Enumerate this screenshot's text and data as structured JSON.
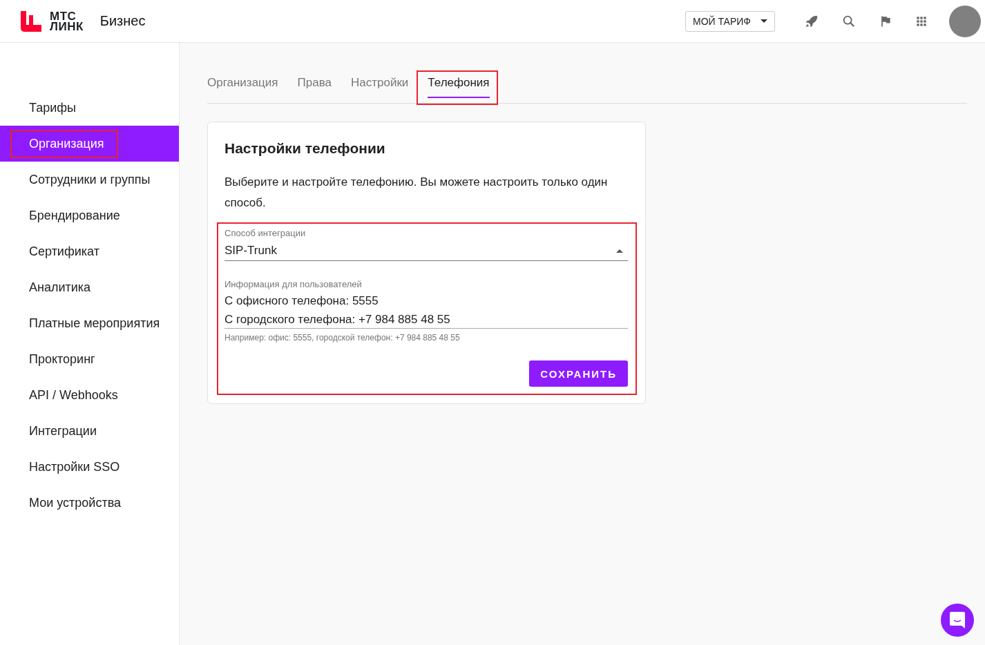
{
  "header": {
    "logo_line1": "МТС",
    "logo_line2": "ЛИНК",
    "product": "Бизнес",
    "plan_button": "МОЙ ТАРИФ"
  },
  "sidebar": {
    "items": [
      {
        "label": "Тарифы",
        "selected": false,
        "highlighted": false
      },
      {
        "label": "Организация",
        "selected": true,
        "highlighted": true
      },
      {
        "label": "Сотрудники и группы",
        "selected": false,
        "highlighted": false
      },
      {
        "label": "Брендирование",
        "selected": false,
        "highlighted": false
      },
      {
        "label": "Сертификат",
        "selected": false,
        "highlighted": false
      },
      {
        "label": "Аналитика",
        "selected": false,
        "highlighted": false
      },
      {
        "label": "Платные мероприятия",
        "selected": false,
        "highlighted": false
      },
      {
        "label": "Прокторинг",
        "selected": false,
        "highlighted": false
      },
      {
        "label": "API / Webhooks",
        "selected": false,
        "highlighted": false
      },
      {
        "label": "Интеграции",
        "selected": false,
        "highlighted": false
      },
      {
        "label": "Настройки SSO",
        "selected": false,
        "highlighted": false
      },
      {
        "label": "Мои устройства",
        "selected": false,
        "highlighted": false
      }
    ]
  },
  "tabs": [
    {
      "label": "Организация",
      "selected": false,
      "highlighted": false
    },
    {
      "label": "Права",
      "selected": false,
      "highlighted": false
    },
    {
      "label": "Настройки",
      "selected": false,
      "highlighted": false
    },
    {
      "label": "Телефония",
      "selected": true,
      "highlighted": true
    }
  ],
  "card": {
    "title": "Настройки телефонии",
    "description": "Выберите и настройте телефонию. Вы можете настроить только один способ.",
    "form": {
      "highlighted": true,
      "select": {
        "label": "Способ интеграции",
        "value": "SIP-Trunk",
        "expanded": true
      },
      "info": {
        "label": "Информация для пользователей",
        "lines": [
          "С офисного телефона: 5555",
          "С городского телефона: +7 984 885 48 55"
        ],
        "hint": "Например: офис: 5555, городской телефон: +7 984 885 48 55"
      },
      "save_button": "СОХРАНИТЬ"
    }
  }
}
